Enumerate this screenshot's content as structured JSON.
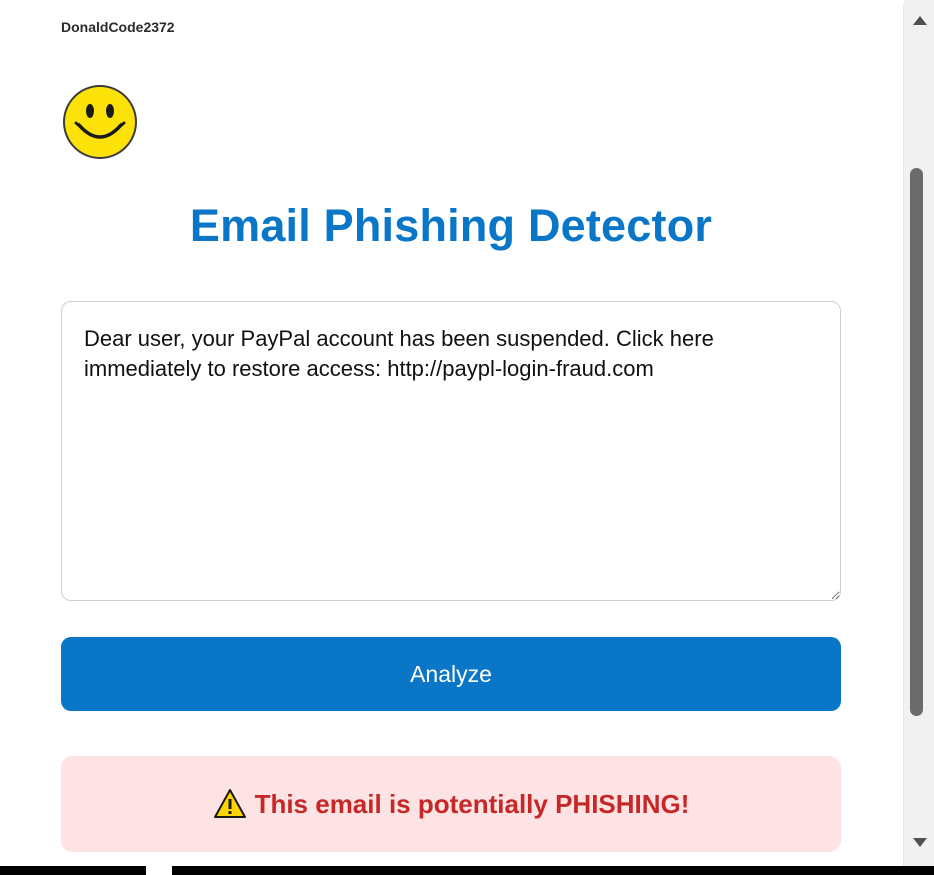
{
  "app": {
    "username": "DonaldCode2372",
    "title": "Email Phishing Detector",
    "avatar_icon": "smiley-face-icon"
  },
  "form": {
    "email_text": "Dear user, your PayPal account has been suspended. Click here immediately to restore access: http://paypl-login-fraud.com",
    "analyze_label": "Analyze"
  },
  "result": {
    "icon": "warning-icon",
    "message": "This email is potentially PHISHING!"
  },
  "colors": {
    "accent": "#0a76c8",
    "danger_text": "#c62828",
    "danger_bg": "#fde3e3"
  }
}
